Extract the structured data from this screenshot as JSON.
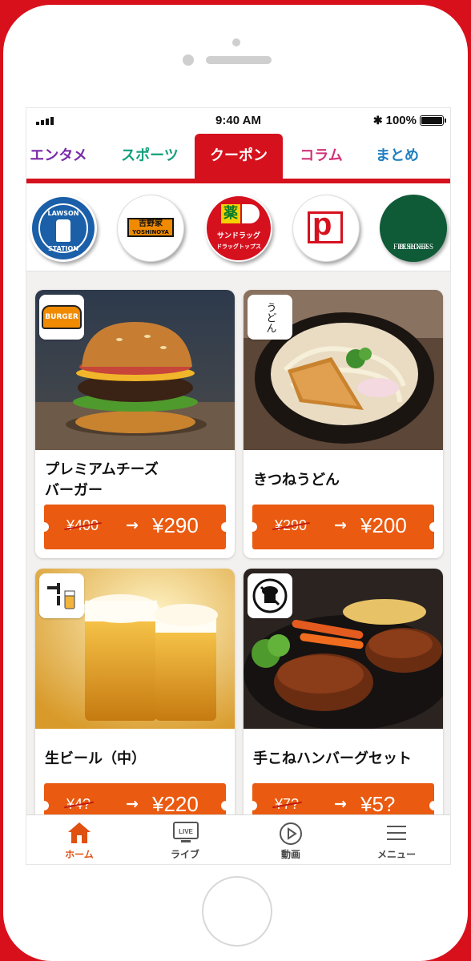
{
  "statusbar": {
    "time": "9:40 AM",
    "battery": "100%"
  },
  "tabs": [
    {
      "label": "エンタメ",
      "color": "#7a2aa8",
      "active": false
    },
    {
      "label": "スポーツ",
      "color": "#12a07c",
      "active": false
    },
    {
      "label": "クーポン",
      "color": "#ffffff",
      "active": true
    },
    {
      "label": "コラム",
      "color": "#d0337a",
      "active": false
    },
    {
      "label": "まとめ",
      "color": "#1f7fc0",
      "active": false
    }
  ],
  "brands": {
    "lawson": {
      "top": "LAWSON",
      "bottom": "STATION"
    },
    "yoshinoya": {
      "kanji": "吉野家",
      "roman": "YOSHINOYA"
    },
    "sundrug": {
      "kanji": "薬",
      "name": "サンドラッグ",
      "sub": "ドラッグトップス"
    },
    "poplar": {
      "letter": "p"
    },
    "freshness": {
      "line1": "FRESHNESS",
      "line2": "BURGER"
    }
  },
  "coupons": [
    {
      "name_line1": "プレミアムチーズ",
      "name_line2": "バーガー",
      "old_price": "¥400",
      "new_price": "¥290",
      "icon": "burger-logo-icon",
      "icon_text": "BURGER"
    },
    {
      "name_line1": "きつねうどん",
      "name_line2": "",
      "old_price": "¥290",
      "new_price": "¥200",
      "icon": "udon-logo-icon",
      "icon_text": "うどん"
    },
    {
      "name_line1": "生ビール（中）",
      "name_line2": "",
      "old_price": "¥4?",
      "new_price": "¥220",
      "icon": "beer-tap-icon",
      "icon_text": ""
    },
    {
      "name_line1": "手こねハンバーグセット",
      "name_line2": "",
      "old_price": "¥7?",
      "new_price": "¥5?",
      "icon": "chef-logo-icon",
      "icon_text": ""
    }
  ],
  "coupon_arrow": "→",
  "bottomnav": [
    {
      "label": "ホーム",
      "icon": "home-icon",
      "active": true
    },
    {
      "label": "ライブ",
      "icon": "live-tv-icon",
      "active": false,
      "icon_text": "LIVE"
    },
    {
      "label": "動画",
      "icon": "play-icon",
      "active": false
    },
    {
      "label": "メニュー",
      "icon": "hamburger-menu-icon",
      "active": false
    }
  ],
  "colors": {
    "brand_red": "#d6111e",
    "coupon_orange": "#ea5a10",
    "active_nav": "#e05010"
  }
}
